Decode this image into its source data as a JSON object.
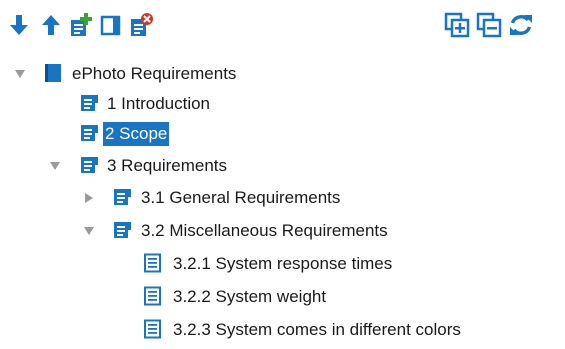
{
  "toolbar": {
    "buttons": [
      {
        "name": "move-down-button",
        "icon": "arrow-down-icon"
      },
      {
        "name": "move-up-button",
        "icon": "arrow-up-icon"
      },
      {
        "name": "add-child-button",
        "icon": "add-document-icon"
      },
      {
        "name": "add-sibling-button",
        "icon": "blank-document-icon"
      },
      {
        "name": "delete-button",
        "icon": "delete-document-icon"
      },
      {
        "name": "expand-all-button",
        "icon": "expand-all-icon"
      },
      {
        "name": "collapse-all-button",
        "icon": "collapse-all-icon"
      },
      {
        "name": "refresh-button",
        "icon": "refresh-icon"
      }
    ]
  },
  "tree": {
    "root": {
      "label": "ePhoto Requirements",
      "expanded": true
    },
    "items": [
      {
        "label": "1 Introduction",
        "level": 1,
        "selected": false
      },
      {
        "label": "2 Scope",
        "level": 1,
        "selected": true
      },
      {
        "label": "3 Requirements",
        "level": 1,
        "expanded": true
      },
      {
        "label": "3.1 General Requirements",
        "level": 2,
        "expanded": false
      },
      {
        "label": "3.2 Miscellaneous Requirements",
        "level": 2,
        "expanded": true
      },
      {
        "label": "3.2.1 System response times",
        "level": 3
      },
      {
        "label": "3.2.2 System weight",
        "level": 3
      },
      {
        "label": "3.2.3 System comes in different colors",
        "level": 3
      }
    ]
  },
  "colors": {
    "accent": "#1a74c4",
    "add": "#3aa335",
    "delete": "#d0342c",
    "twisty": "#9a9a9a"
  }
}
